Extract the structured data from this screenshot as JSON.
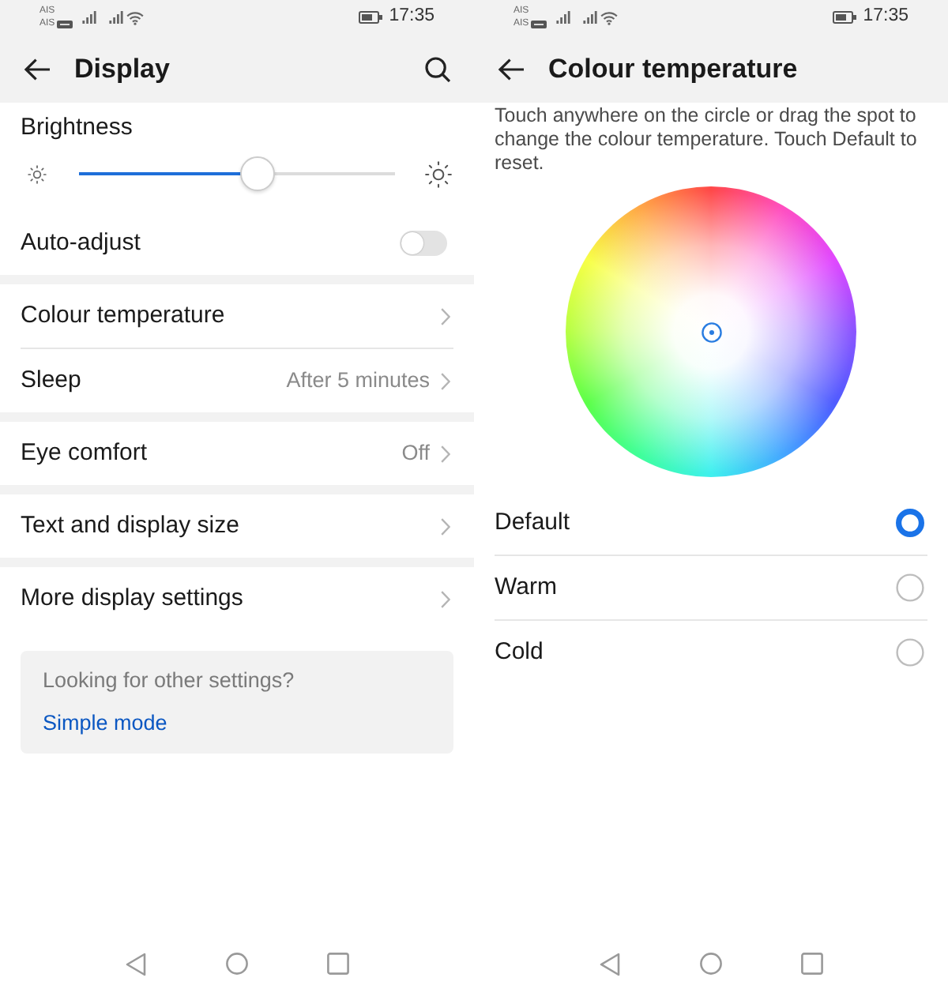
{
  "display_screen": {
    "status_bar": {
      "carriers": [
        {
          "name": "AIS",
          "badge": false
        },
        {
          "name": "AIS",
          "badge": true
        }
      ],
      "time": "17:35"
    },
    "header": {
      "title": "Display",
      "search": true
    },
    "brightness": {
      "label": "Brightness",
      "level": 0.565
    },
    "groups": [
      {
        "items": [
          {
            "kind": "toggle",
            "label": "Auto-adjust",
            "on": false
          }
        ]
      },
      {
        "items": [
          {
            "kind": "link",
            "label": "Colour temperature"
          },
          {
            "kind": "link",
            "label": "Sleep",
            "value": "After 5 minutes"
          }
        ]
      },
      {
        "items": [
          {
            "kind": "link",
            "label": "Eye comfort",
            "value": "Off"
          }
        ]
      },
      {
        "items": [
          {
            "kind": "link",
            "label": "Text and display size"
          }
        ]
      },
      {
        "items": [
          {
            "kind": "link",
            "label": "More display settings"
          }
        ]
      }
    ],
    "suggestion": {
      "text": "Looking for other settings?",
      "link": "Simple mode"
    }
  },
  "colour_temperature_screen": {
    "status_bar": {
      "carriers": [
        {
          "name": "AIS",
          "badge": false
        },
        {
          "name": "AIS",
          "badge": true
        }
      ],
      "time": "17:35"
    },
    "header": {
      "title": "Colour temperature"
    },
    "description": "Touch anywhere on the circle or drag the spot to change the colour temperature. Touch Default to reset.",
    "options": [
      {
        "label": "Default",
        "selected": true
      },
      {
        "label": "Warm",
        "selected": false
      },
      {
        "label": "Cold",
        "selected": false
      }
    ]
  }
}
